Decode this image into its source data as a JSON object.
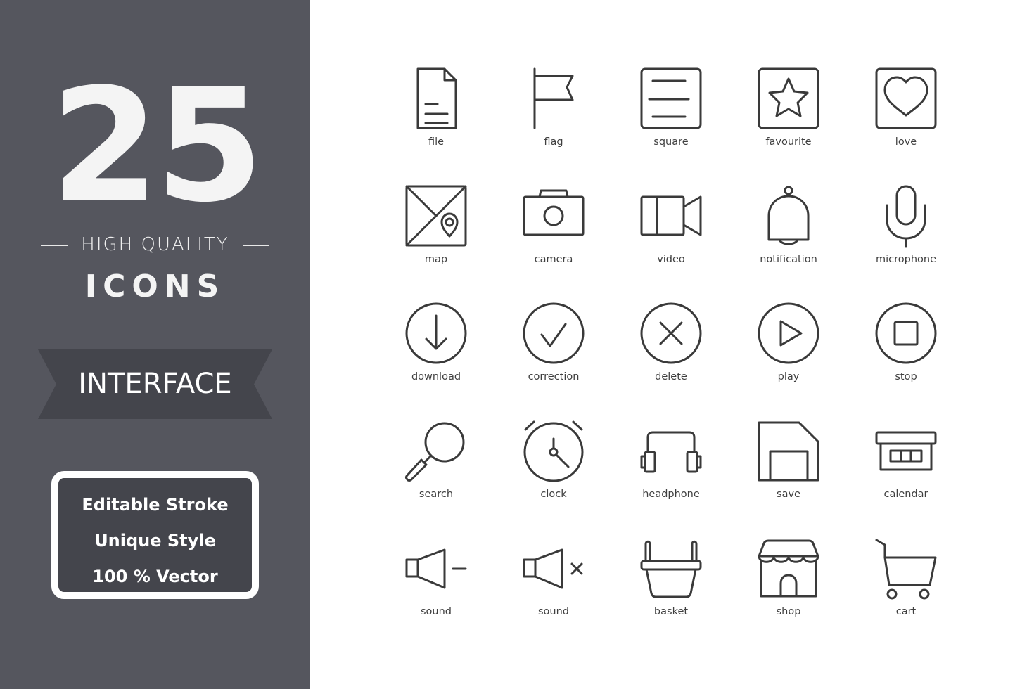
{
  "promo": {
    "count": "25",
    "tagline": "HIGH QUALITY",
    "headline": "ICONS",
    "category": "INTERFACE",
    "features": [
      "Editable Stroke",
      "Unique Style",
      "100 % Vector"
    ]
  },
  "colors": {
    "panel": "#55565e",
    "ribbon": "#44454c",
    "icon_stroke": "#3a3a3a",
    "background": "#ffffff"
  },
  "icons": [
    {
      "name": "file-icon",
      "label": "file"
    },
    {
      "name": "flag-icon",
      "label": "flag"
    },
    {
      "name": "square-icon",
      "label": "square"
    },
    {
      "name": "favourite-icon",
      "label": "favourite"
    },
    {
      "name": "love-icon",
      "label": "love"
    },
    {
      "name": "map-icon",
      "label": "map"
    },
    {
      "name": "camera-icon",
      "label": "camera"
    },
    {
      "name": "video-icon",
      "label": "video"
    },
    {
      "name": "notification-icon",
      "label": "notification"
    },
    {
      "name": "microphone-icon",
      "label": "microphone"
    },
    {
      "name": "download-icon",
      "label": "download"
    },
    {
      "name": "correction-icon",
      "label": "correction"
    },
    {
      "name": "delete-icon",
      "label": "delete"
    },
    {
      "name": "play-icon",
      "label": "play"
    },
    {
      "name": "stop-icon",
      "label": "stop"
    },
    {
      "name": "search-icon",
      "label": "search"
    },
    {
      "name": "clock-icon",
      "label": "clock"
    },
    {
      "name": "headphone-icon",
      "label": "headphone"
    },
    {
      "name": "save-icon",
      "label": "save"
    },
    {
      "name": "calendar-icon",
      "label": "calendar"
    },
    {
      "name": "sound-low-icon",
      "label": "sound"
    },
    {
      "name": "sound-mute-icon",
      "label": "sound"
    },
    {
      "name": "basket-icon",
      "label": "basket"
    },
    {
      "name": "shop-icon",
      "label": "shop"
    },
    {
      "name": "cart-icon",
      "label": "cart"
    }
  ]
}
